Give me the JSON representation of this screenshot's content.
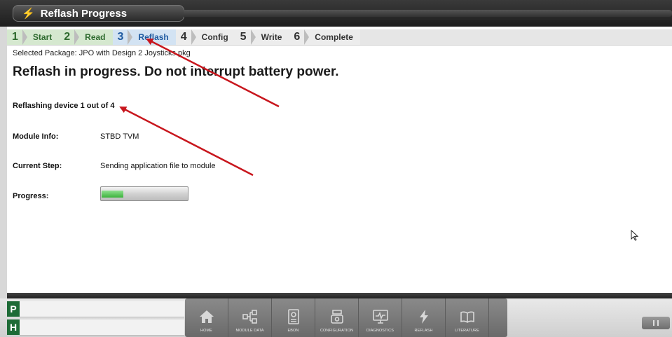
{
  "window": {
    "title": "Reflash Progress",
    "title_icon": "lightning-bolt-icon"
  },
  "steps": [
    {
      "num": "1",
      "label": "Start",
      "state": "done"
    },
    {
      "num": "2",
      "label": "Read",
      "state": "done"
    },
    {
      "num": "3",
      "label": "Reflash",
      "state": "active"
    },
    {
      "num": "4",
      "label": "Config",
      "state": "pending"
    },
    {
      "num": "5",
      "label": "Write",
      "state": "pending"
    },
    {
      "num": "6",
      "label": "Complete",
      "state": "pending"
    }
  ],
  "selected_package": "Selected Package: JPO with Design 2 Joysticks.pkg",
  "headline": "Reflash in progress. Do not interrupt battery power.",
  "status": "Reflashing device 1 out of 4",
  "module_info": {
    "label": "Module Info:",
    "value": "STBD TVM"
  },
  "current_step": {
    "label": "Current Step:",
    "value": "Sending application file to module"
  },
  "progress": {
    "label": "Progress:",
    "fraction": 0.25
  },
  "sidebar_letters": [
    "P",
    "H"
  ],
  "nav": [
    {
      "label": "HOME",
      "icon": "home-icon"
    },
    {
      "label": "MODULE DATA",
      "icon": "module-data-icon"
    },
    {
      "label": "EBON",
      "icon": "ebon-icon"
    },
    {
      "label": "CONFIGURATION",
      "icon": "configuration-icon"
    },
    {
      "label": "DIAGNOSTICS",
      "icon": "diagnostics-icon"
    },
    {
      "label": "REFLASH",
      "icon": "reflash-icon"
    },
    {
      "label": "LITERATURE",
      "icon": "literature-icon"
    }
  ],
  "colors": {
    "done_green": "#2e6a2e",
    "active_blue": "#1f5aa0",
    "progress_green": "#3cb33c",
    "annotation_red": "#c8161d"
  }
}
